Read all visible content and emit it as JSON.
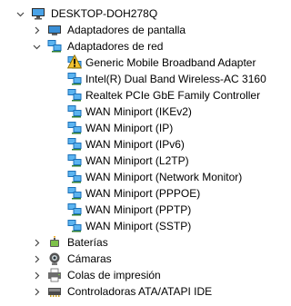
{
  "tree": {
    "root": {
      "label": "DESKTOP-DOH278Q"
    },
    "display_adapters": {
      "label": "Adaptadores de pantalla"
    },
    "network_adapters": {
      "label": "Adaptadores de red",
      "devices": [
        "Generic Mobile Broadband Adapter",
        "Intel(R) Dual Band Wireless-AC 3160",
        "Realtek PCIe GbE Family Controller",
        "WAN Miniport (IKEv2)",
        "WAN Miniport (IP)",
        "WAN Miniport (IPv6)",
        "WAN Miniport (L2TP)",
        "WAN Miniport (Network Monitor)",
        "WAN Miniport (PPPOE)",
        "WAN Miniport (PPTP)",
        "WAN Miniport (SSTP)"
      ]
    },
    "batteries": {
      "label": "Baterías"
    },
    "cameras": {
      "label": "Cámaras"
    },
    "print_queues": {
      "label": "Colas de impresión"
    },
    "ata_controllers": {
      "label": "Controladoras ATA/ATAPI IDE"
    }
  },
  "colors": {
    "accent": "#1e88d9",
    "warning": "#f2c230"
  }
}
